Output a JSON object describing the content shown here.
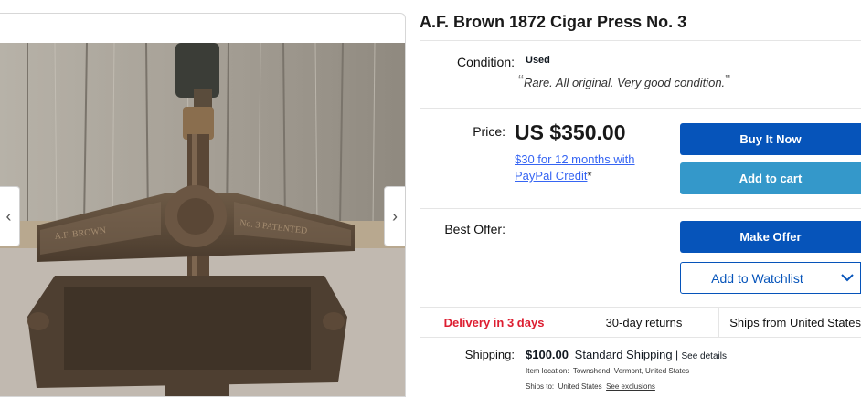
{
  "title": "A.F. Brown 1872 Cigar Press No. 3",
  "gallery": {
    "prev_glyph": "‹",
    "next_glyph": "›",
    "image_alt": "cast iron cigar press"
  },
  "condition": {
    "label": "Condition:",
    "value": "Used",
    "open_quote": "“",
    "quote": "Rare. All original. Very good condition.",
    "close_quote": "”"
  },
  "price": {
    "label": "Price:",
    "amount": "US $350.00",
    "credit_text": "$30 for 12 months with PayPal Credit",
    "credit_mark": "*"
  },
  "buttons": {
    "buy_now": "Buy It Now",
    "add_to_cart": "Add to cart",
    "make_offer": "Make Offer",
    "watchlist": "Add to Watchlist",
    "watchlist_dropdown": "chevron-down-icon"
  },
  "best_offer": {
    "label": "Best Offer:"
  },
  "highlights": {
    "delivery": "Delivery in 3 days",
    "returns": "30-day returns",
    "ships_from": "Ships from United States"
  },
  "shipping": {
    "label": "Shipping:",
    "cost": "$100.00",
    "service": "Standard Shipping",
    "separator": "|",
    "details_link": "See details",
    "location_label": "Item location:",
    "location": "Townshend, Vermont, United States",
    "ships_to_label": "Ships to:",
    "ships_to": "United States",
    "exclusions_link": "See exclusions"
  },
  "colors": {
    "primary_button": "#0654ba",
    "secondary_button": "#3498ca",
    "link": "#3665f3",
    "delivery_highlight": "#dd1e31"
  }
}
